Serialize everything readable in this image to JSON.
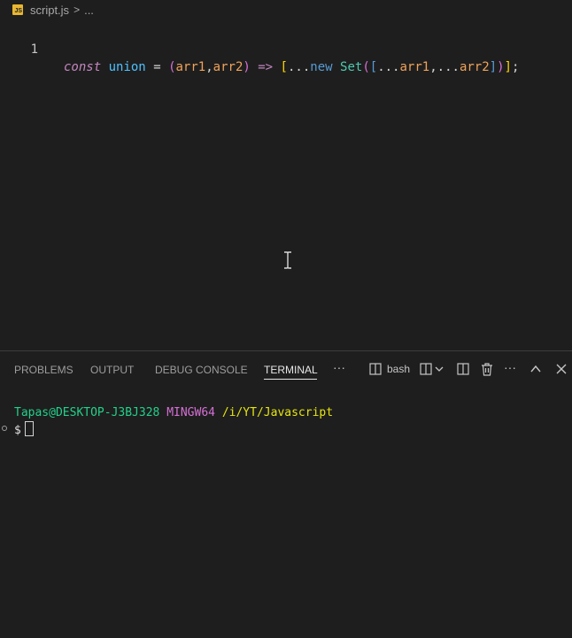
{
  "breadcrumb": {
    "file_icon_text": "JS",
    "file": "script.js",
    "separator": ">",
    "ellipsis": "..."
  },
  "editor": {
    "line_number": "1",
    "code": {
      "kw_const": "const",
      "name": "union",
      "eq": "=",
      "lparen": "(",
      "p1": "arr1",
      "comma1": ",",
      "p2": "arr2",
      "rparen": ")",
      "arrow": "=>",
      "lbracket": "[",
      "spread1": "...",
      "kw_new": "new",
      "set": "Set",
      "lparen2": "(",
      "lbracket2": "[",
      "spread2": "...",
      "a1": "arr1",
      "comma2": ",",
      "spread3": "...",
      "a2": "arr2",
      "rbracket2": "]",
      "rparen2": ")",
      "rbracket": "]",
      "semi": ";"
    }
  },
  "panel": {
    "tabs": [
      "PROBLEMS",
      "OUTPUT",
      "DEBUG CONSOLE",
      "TERMINAL"
    ],
    "active_tab": "TERMINAL",
    "more": "···",
    "shell_label": "bash",
    "toolbar_more": "···"
  },
  "terminal": {
    "user_host": "Tapas@DESKTOP-J3BJ328",
    "env": "MINGW64",
    "path": "/i/YT/Javascript",
    "prompt": "$"
  },
  "colors": {
    "background": "#1e1e1e",
    "terminal_user": "#23d18b",
    "terminal_env": "#d670d6",
    "terminal_path": "#e5e510"
  }
}
